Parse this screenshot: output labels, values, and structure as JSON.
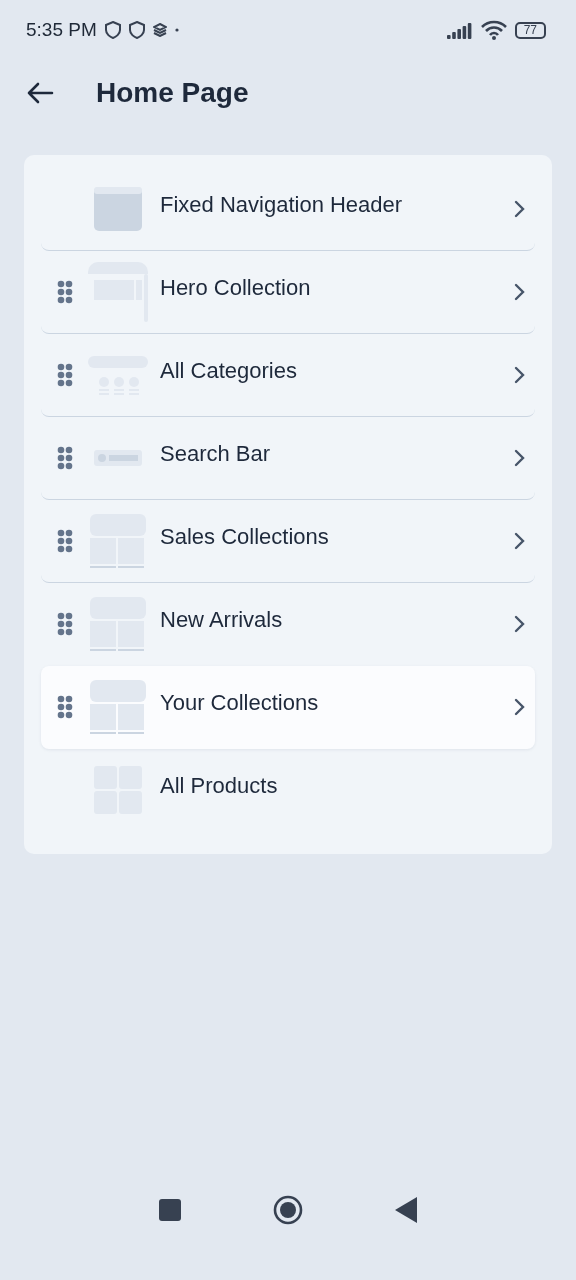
{
  "status_bar": {
    "time": "5:35 PM",
    "battery": "77"
  },
  "header": {
    "title": "Home Page"
  },
  "sections": [
    {
      "label": "Fixed Navigation Header",
      "kind": "header",
      "draggable": false,
      "chevron": true,
      "selected": false
    },
    {
      "label": "Hero Collection",
      "kind": "hero",
      "draggable": true,
      "chevron": true,
      "selected": false
    },
    {
      "label": "All Categories",
      "kind": "categories",
      "draggable": true,
      "chevron": true,
      "selected": false
    },
    {
      "label": "Search Bar",
      "kind": "search",
      "draggable": true,
      "chevron": true,
      "selected": false
    },
    {
      "label": "Sales Collections",
      "kind": "grid",
      "draggable": true,
      "chevron": true,
      "selected": false
    },
    {
      "label": "New Arrivals",
      "kind": "grid",
      "draggable": true,
      "chevron": true,
      "selected": false
    },
    {
      "label": "Your Collections",
      "kind": "grid",
      "draggable": true,
      "chevron": true,
      "selected": true
    },
    {
      "label": "All Products",
      "kind": "products",
      "draggable": false,
      "chevron": false,
      "selected": false
    }
  ]
}
